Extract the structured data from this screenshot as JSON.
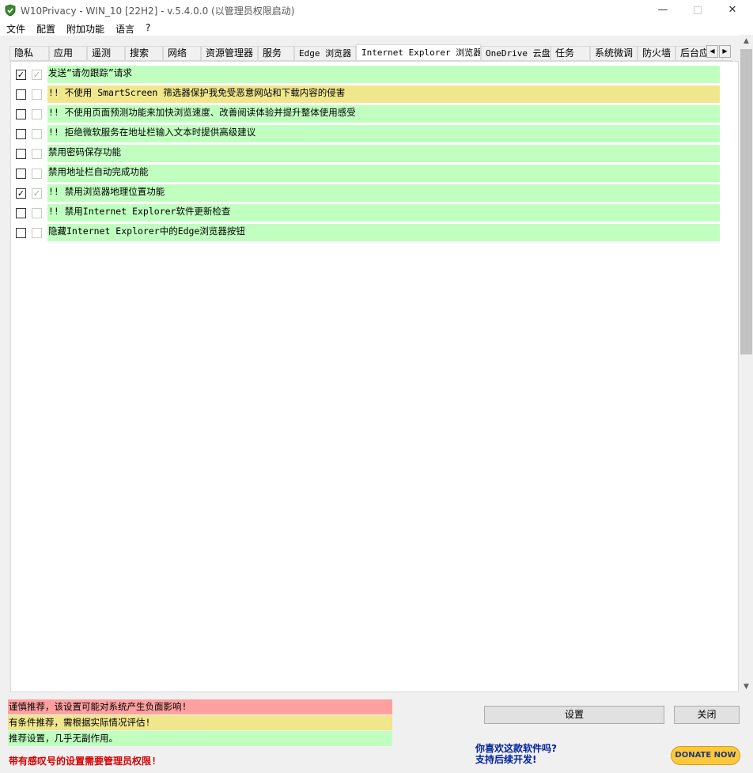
{
  "window": {
    "title": "W10Privacy - WIN_10 [22H2]  - v.5.4.0.0 (以管理员权限启动)"
  },
  "menu": [
    "文件",
    "配置",
    "附加功能",
    "语言",
    "?"
  ],
  "tabs": [
    "隐私",
    "应用",
    "遥测",
    "搜索",
    "网络",
    "资源管理器",
    "服务",
    "Edge 浏览器",
    "Internet Explorer 浏览器",
    "OneDrive 云盘",
    "任务",
    "系统微调",
    "防火墙",
    "后台应"
  ],
  "active_tab": "Internet Explorer 浏览器",
  "options": [
    {
      "label": "发送“请勿跟踪”请求",
      "checked": true,
      "admin_checked": true,
      "level": "green"
    },
    {
      "label": "!! 不使用 SmartScreen 筛选器保护我免受恶意网站和下载内容的侵害",
      "checked": false,
      "admin_checked": false,
      "level": "yellow"
    },
    {
      "label": "!! 不使用页面预测功能来加快浏览速度、改善阅读体验并提升整体使用感受",
      "checked": false,
      "admin_checked": false,
      "level": "green"
    },
    {
      "label": "!! 拒绝微软服务在地址栏输入文本时提供高级建议",
      "checked": false,
      "admin_checked": false,
      "level": "green"
    },
    {
      "label": "禁用密码保存功能",
      "checked": false,
      "admin_checked": false,
      "level": "green"
    },
    {
      "label": "禁用地址栏自动完成功能",
      "checked": false,
      "admin_checked": false,
      "level": "green"
    },
    {
      "label": "!! 禁用浏览器地理位置功能",
      "checked": true,
      "admin_checked": true,
      "level": "green"
    },
    {
      "label": "!! 禁用Internet Explorer软件更新检查",
      "checked": false,
      "admin_checked": false,
      "level": "green"
    },
    {
      "label": "隐藏Internet Explorer中的Edge浏览器按钮",
      "checked": false,
      "admin_checked": false,
      "level": "green"
    }
  ],
  "legend": {
    "red": "谨慎推荐，该设置可能对系统产生负面影响!",
    "yellow": "有条件推荐，需根据实际情况评估!",
    "green": "推荐设置，几乎无副作用。"
  },
  "admin_note": "带有感叹号的设置需要管理员权限!",
  "buttons": {
    "apply": "设置",
    "close": "关闭"
  },
  "promo": {
    "line1": "你喜欢这款软件吗?",
    "line2": "支持后续开发!"
  },
  "donate_label": "DONATE NOW",
  "colors": {
    "green": "#c0ffc0",
    "yellow": "#f0e68c",
    "red": "#ffa0a0",
    "admin_note": "#d40000",
    "promo": "#00209f"
  },
  "icons": {
    "app": "shield-check-icon",
    "check": "checkmark-icon"
  }
}
